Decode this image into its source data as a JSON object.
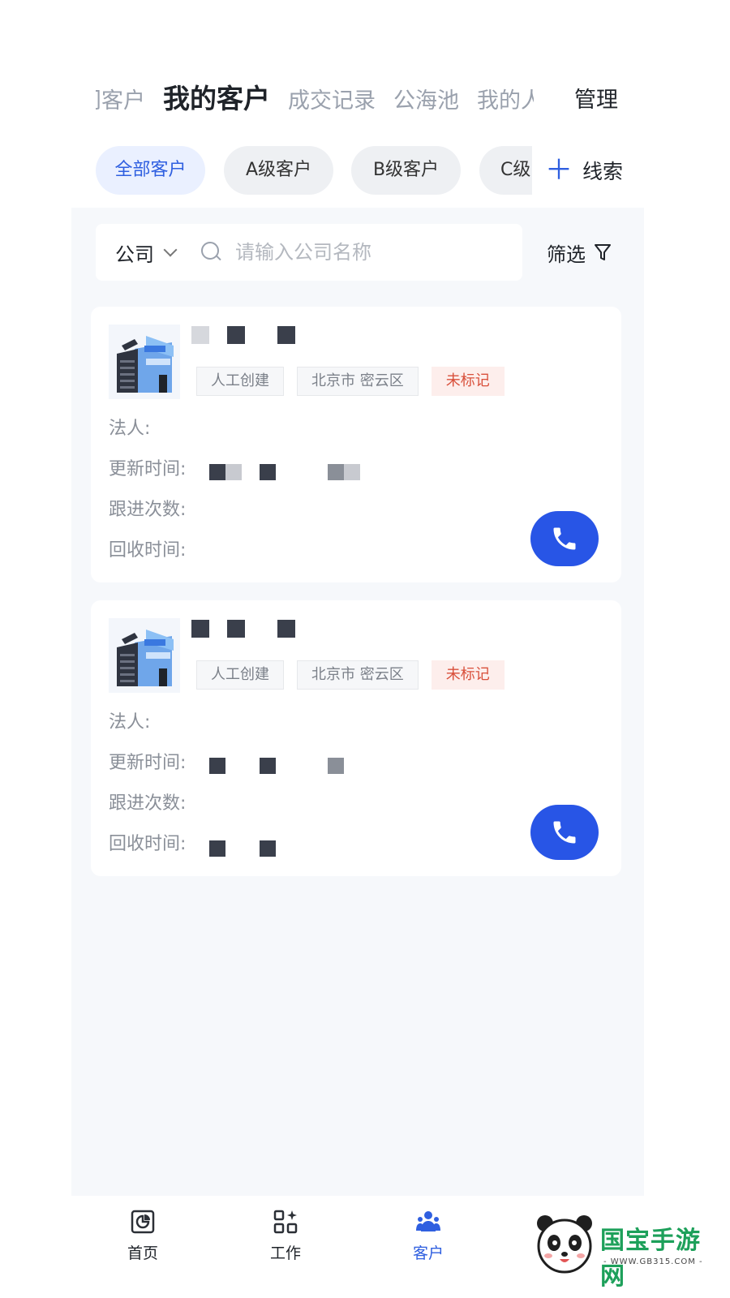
{
  "tabs": [
    {
      "label": "门客户",
      "active": false
    },
    {
      "label": "我的客户",
      "active": true
    },
    {
      "label": "成交记录",
      "active": false
    },
    {
      "label": "公海池",
      "active": false
    },
    {
      "label": "我的人脉",
      "active": false
    }
  ],
  "manage_label": "管理",
  "levels": [
    {
      "label": "全部客户",
      "active": true
    },
    {
      "label": "A级客户",
      "active": false
    },
    {
      "label": "B级客户",
      "active": false
    },
    {
      "label": "C级",
      "active": false
    }
  ],
  "clue_label": "线索",
  "search": {
    "scope": "公司",
    "placeholder": "请输入公司名称"
  },
  "filter_label": "筛选",
  "fields": {
    "legal": "法人:",
    "updated": "更新时间:",
    "follow": "跟进次数:",
    "recycle": "回收时间:"
  },
  "cards": [
    {
      "tags": [
        "人工创建",
        "北京市 密云区",
        "未标记"
      ]
    },
    {
      "tags": [
        "人工创建",
        "北京市 密云区",
        "未标记"
      ]
    }
  ],
  "nav": [
    {
      "label": "首页",
      "icon": "home-icon",
      "active": false
    },
    {
      "label": "工作",
      "icon": "work-grid-icon",
      "active": false
    },
    {
      "label": "客户",
      "icon": "customers-icon",
      "active": true
    }
  ],
  "watermark": {
    "text": "国宝手游网",
    "url": "- WWW.GB315.COM -"
  },
  "colors": {
    "accent": "#2f5fe0",
    "call_button": "#2855e6",
    "warn_tag": "#d9503b"
  }
}
